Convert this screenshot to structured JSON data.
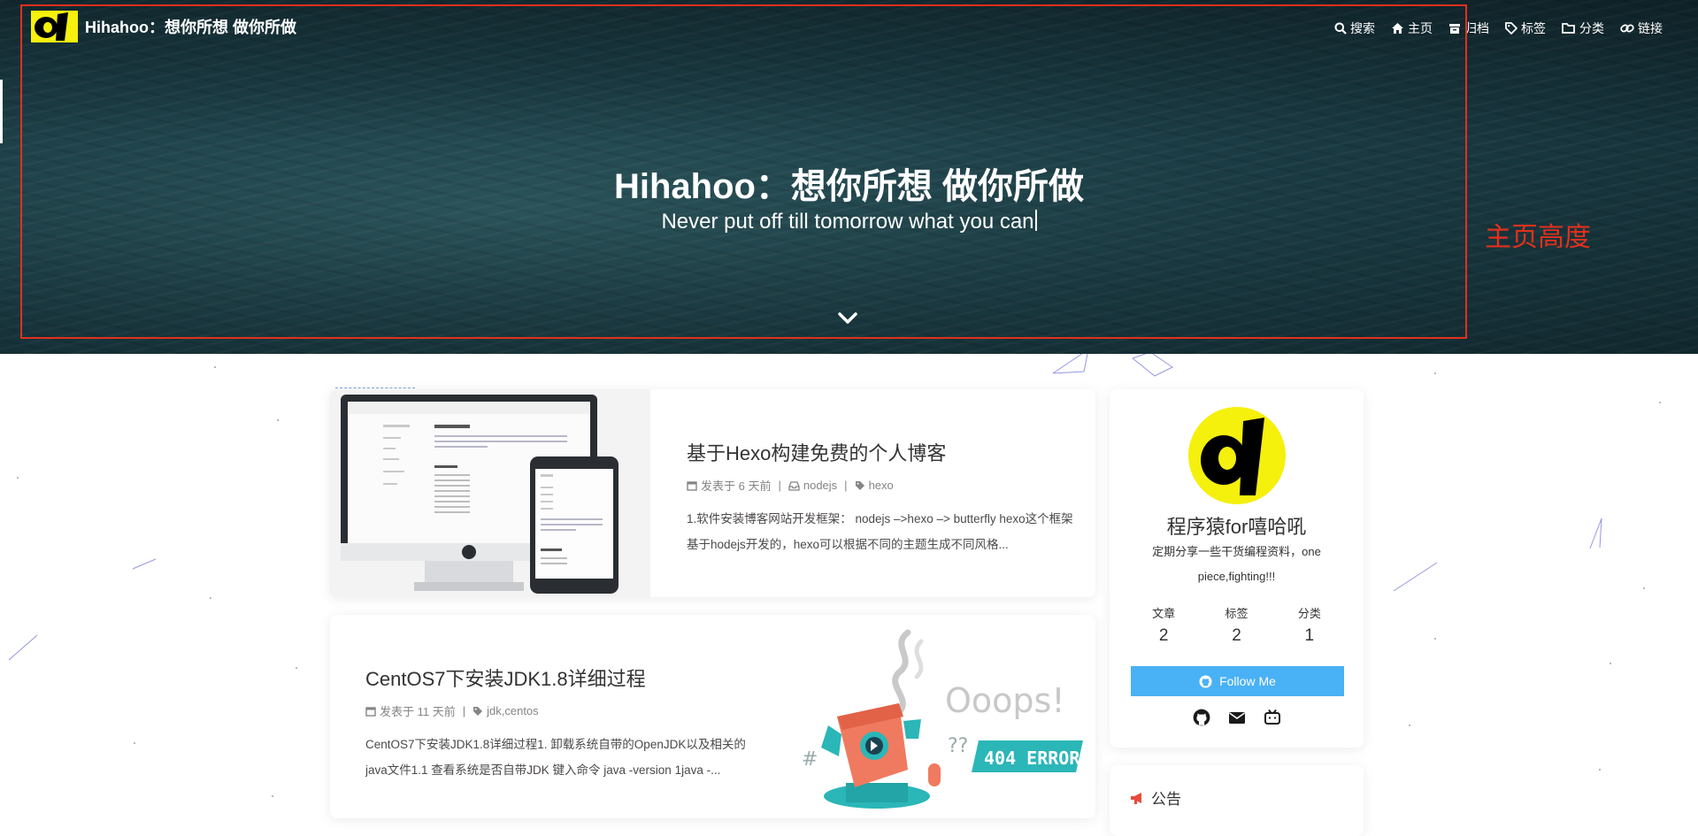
{
  "nav": {
    "site_name": "Hihahoo：想你所想 做你所做",
    "menu": [
      {
        "label": "搜索",
        "icon": "search-icon"
      },
      {
        "label": "主页",
        "icon": "home-icon"
      },
      {
        "label": "归档",
        "icon": "archive-icon"
      },
      {
        "label": "标签",
        "icon": "tag-icon"
      },
      {
        "label": "分类",
        "icon": "folder-icon"
      },
      {
        "label": "链接",
        "icon": "link-icon"
      }
    ]
  },
  "hero": {
    "title": "Hihahoo：想你所想 做你所做",
    "subtitle": "Never put off till tomorrow what you can"
  },
  "annotation": {
    "label": "主页高度",
    "color": "#e3301c"
  },
  "posts": [
    {
      "title": "基于Hexo构建免费的个人博客",
      "date": "发表于 6 天前",
      "category": "nodejs",
      "tags": "hexo",
      "excerpt": "1.软件安装博客网站开发框架： nodejs –>hexo –> butterfly hexo这个框架基于hodejs开发的，hexo可以根据不同的主题生成不同风格..."
    },
    {
      "title": "CentOS7下安装JDK1.8详细过程",
      "date": "发表于 11 天前",
      "tags": "jdk,centos",
      "excerpt": "CentOS7下安装JDK1.8详细过程1. 卸载系统自带的OpenJDK以及相关的java文件1.1 查看系统是否自带JDK 键入命令 java -version 1java -..."
    }
  ],
  "cover2": {
    "headline": "Ooops!",
    "badge": "404 ERROR"
  },
  "author": {
    "name": "程序猿for嘻哈吼",
    "description": "定期分享一些干货编程资料，one piece,fighting!!!",
    "stats": [
      {
        "label": "文章",
        "value": "2"
      },
      {
        "label": "标签",
        "value": "2"
      },
      {
        "label": "分类",
        "value": "1"
      }
    ],
    "follow_label": "Follow Me",
    "social_icons": [
      "github-icon",
      "email-icon",
      "bilibili-icon"
    ]
  },
  "announcement": {
    "title": "公告",
    "icon": "bullhorn-icon"
  },
  "colors": {
    "accent": "#49b1f5",
    "logo_yellow": "#f5f00c"
  }
}
